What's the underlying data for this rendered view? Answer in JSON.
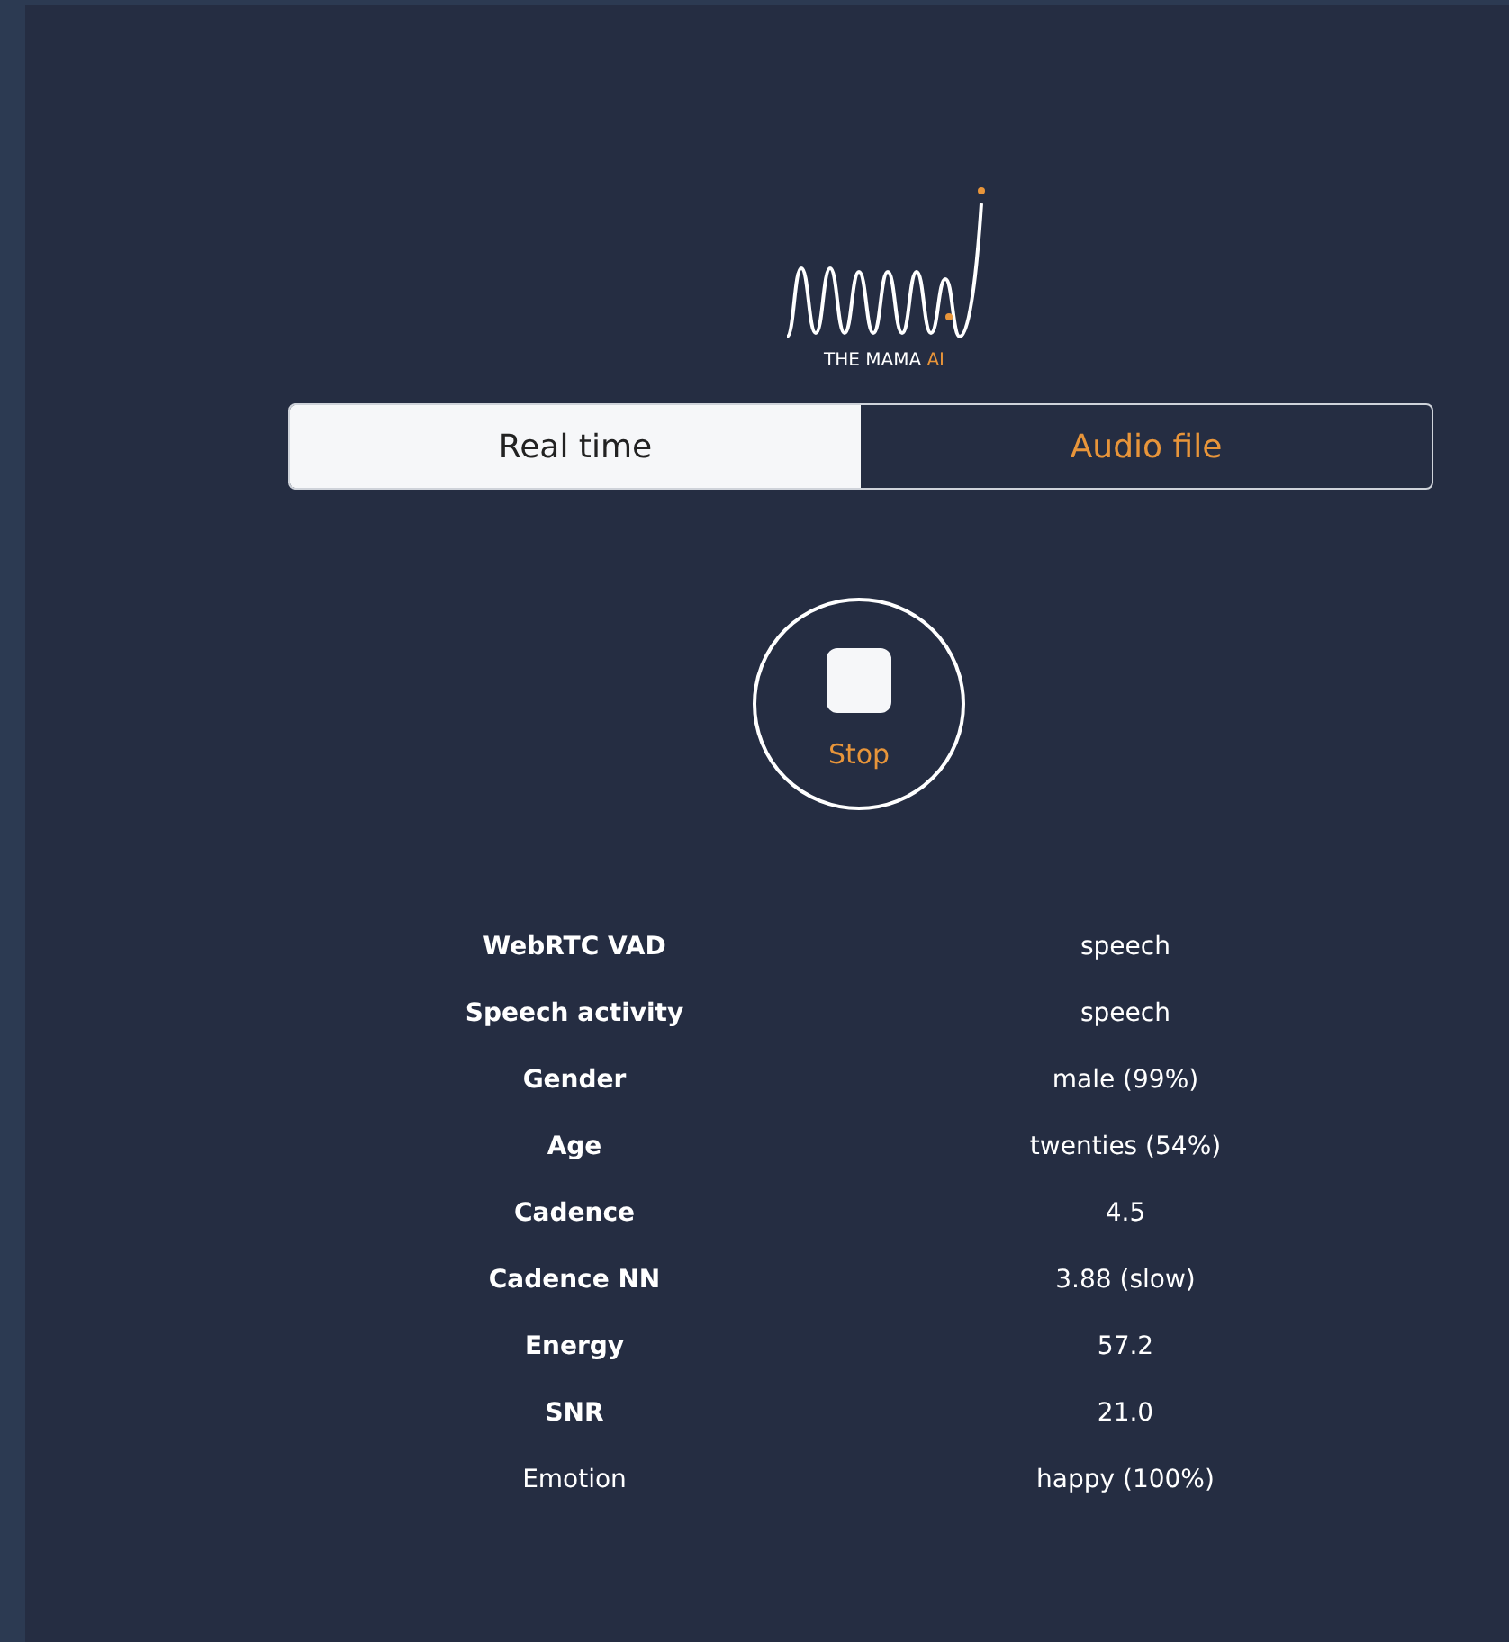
{
  "logo": {
    "name": "THE MAMA",
    "accent": "AI"
  },
  "tabs": [
    {
      "label": "Real time",
      "selected": true
    },
    {
      "label": "Audio file",
      "selected": false
    }
  ],
  "record_button": {
    "label": "Stop"
  },
  "results": [
    {
      "label": "WebRTC VAD",
      "value": "speech",
      "bold": true
    },
    {
      "label": "Speech activity",
      "value": "speech",
      "bold": true
    },
    {
      "label": "Gender",
      "value": "male (99%)",
      "bold": true
    },
    {
      "label": "Age",
      "value": "twenties (54%)",
      "bold": true
    },
    {
      "label": "Cadence",
      "value": "4.5",
      "bold": true
    },
    {
      "label": "Cadence NN",
      "value": "3.88 (slow)",
      "bold": true
    },
    {
      "label": "Energy",
      "value": "57.2",
      "bold": true
    },
    {
      "label": "SNR",
      "value": "21.0",
      "bold": true
    },
    {
      "label": "Emotion",
      "value": "happy (100%)",
      "bold": false
    }
  ]
}
